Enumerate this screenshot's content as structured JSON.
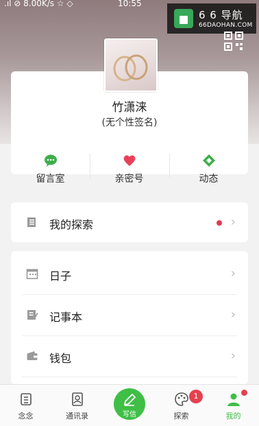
{
  "status_bar": {
    "left": ".ıl ⊘ 8.00K/s ☆ ◇",
    "time": "10:55"
  },
  "watermark": {
    "brand": "6 6 导航",
    "domain": "66DAOHAN.COM"
  },
  "profile": {
    "name": "竹潇涞",
    "signature": "(无个性签名)"
  },
  "actions": [
    {
      "label": "留言室",
      "icon": "chat-bubble-icon",
      "color": "#3dae49"
    },
    {
      "label": "亲密号",
      "icon": "heart-icon",
      "color": "#e9405a"
    },
    {
      "label": "动态",
      "icon": "diamond-icon",
      "color": "#3dae49"
    }
  ],
  "explore_row": {
    "label": "我的探索",
    "icon": "book-icon"
  },
  "menu": [
    {
      "label": "日子",
      "icon": "calendar-icon"
    },
    {
      "label": "记事本",
      "icon": "notepad-icon"
    },
    {
      "label": "钱包",
      "icon": "wallet-icon"
    }
  ],
  "tabs": [
    {
      "label": "念念",
      "icon": "scroll-icon"
    },
    {
      "label": "通讯录",
      "icon": "contacts-icon"
    },
    {
      "label": "写信",
      "icon": "pen-icon"
    },
    {
      "label": "探索",
      "icon": "palette-icon",
      "badge": "1"
    },
    {
      "label": "我的",
      "icon": "person-icon",
      "active": true
    }
  ],
  "colors": {
    "accent": "#3fbf45",
    "alert": "#e4414f"
  }
}
